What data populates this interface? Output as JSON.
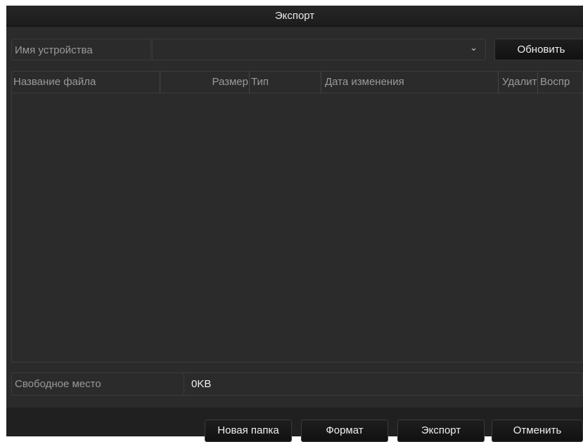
{
  "dialog": {
    "title": "Экспорт"
  },
  "device": {
    "label": "Имя устройства",
    "selected_value": "",
    "refresh_label": "Обновить"
  },
  "table": {
    "columns": [
      "Название файла",
      "Размер",
      "Тип",
      "Дата изменения",
      "Удалит",
      "Воспр"
    ],
    "rows": []
  },
  "free_space": {
    "label": "Свободное место",
    "value": "0KB"
  },
  "footer": {
    "new_folder_label": "Новая папка",
    "format_label": "Формат",
    "export_label": "Экспорт",
    "cancel_label": "Отменить"
  },
  "icons": {
    "dropdown": "chevron-down-icon"
  }
}
